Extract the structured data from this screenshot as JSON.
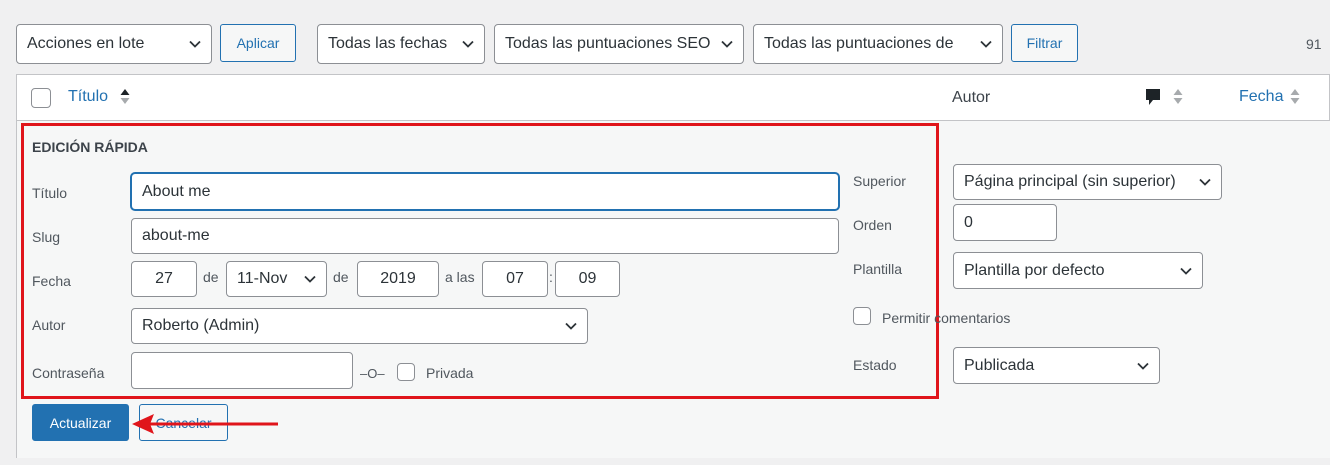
{
  "toolbar": {
    "bulk_actions": "Acciones en lote",
    "apply": "Aplicar",
    "dates": "Todas las fechas",
    "seo_scores": "Todas las puntuaciones SEO",
    "readability_scores": "Todas las puntuaciones de",
    "filter": "Filtrar",
    "items_count": "91"
  },
  "table_header": {
    "title": "Título",
    "author": "Autor",
    "date": "Fecha"
  },
  "quick_edit": {
    "heading": "EDICIÓN RÁPIDA",
    "title_label": "Título",
    "title_value": "About me",
    "slug_label": "Slug",
    "slug_value": "about-me",
    "date_label": "Fecha",
    "day": "27",
    "de1": "de",
    "month": "11-Nov",
    "de2": "de",
    "year": "2019",
    "at": "a las",
    "hour": "07",
    "colon": ":",
    "minute": "09",
    "author_label": "Autor",
    "author_value": "Roberto (Admin)",
    "password_label": "Contraseña",
    "password_value": "",
    "or": "–O–",
    "private": "Privada",
    "parent_label": "Superior",
    "parent_value": "Página principal (sin superior)",
    "order_label": "Orden",
    "order_value": "0",
    "template_label": "Plantilla",
    "template_value": "Plantilla por defecto",
    "allow_comments": "Permitir comentarios",
    "status_label": "Estado",
    "status_value": "Publicada",
    "update": "Actualizar",
    "cancel": "Cancelar"
  },
  "annotation": {
    "highlight_color": "#e0151b",
    "arrow_color": "#e0151b"
  },
  "colors": {
    "primary": "#2271b1",
    "background": "#f0f0f1"
  }
}
